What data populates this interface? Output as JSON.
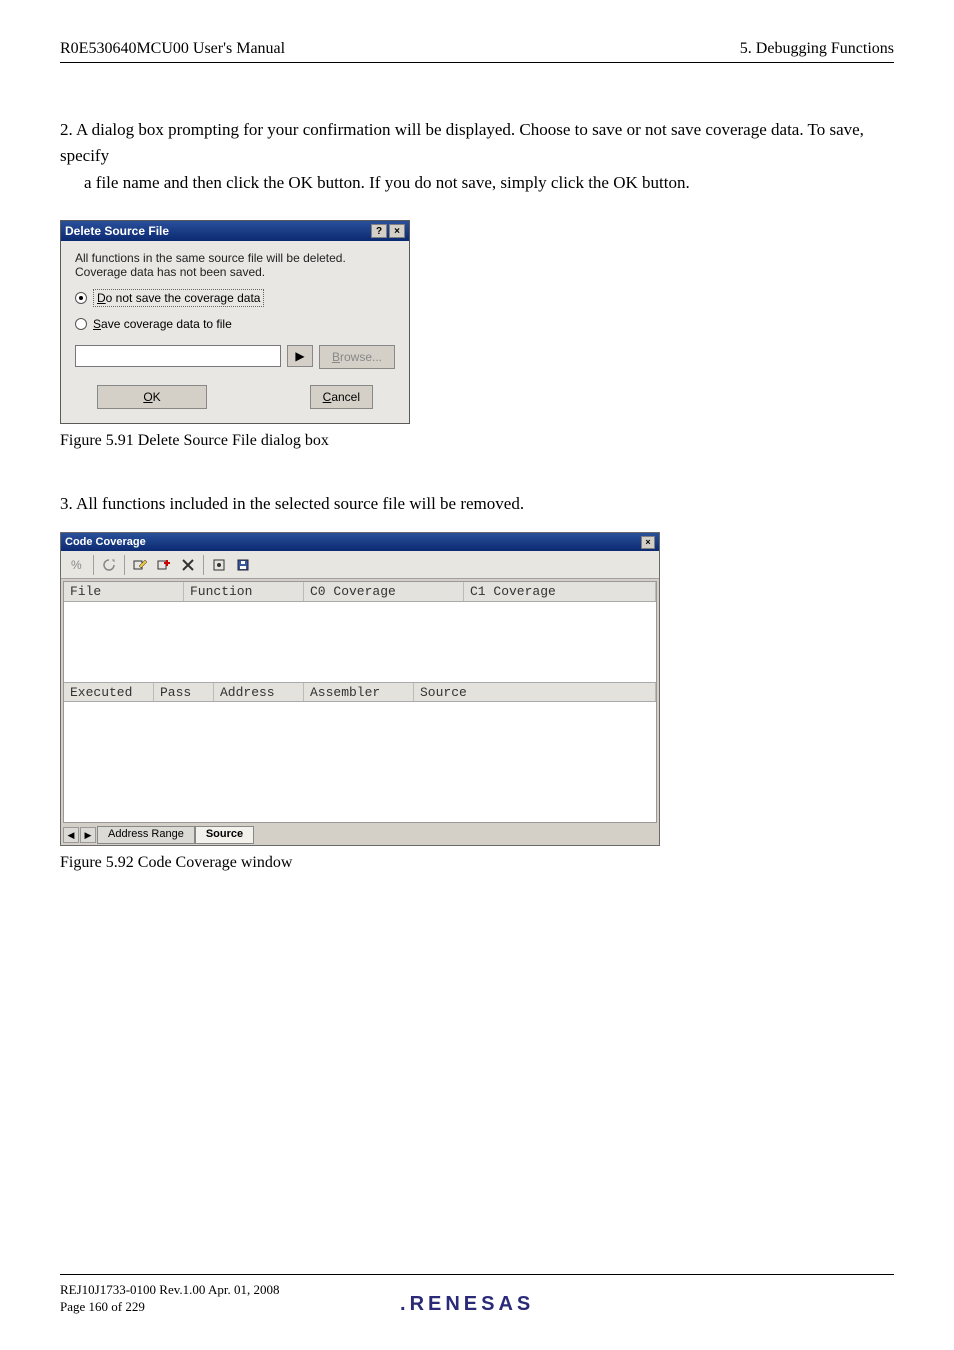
{
  "header": {
    "left": "R0E530640MCU00 User's Manual",
    "right": "5. Debugging Functions"
  },
  "step2": {
    "line1": "2. A dialog box prompting for your confirmation will be displayed. Choose to save or not save coverage data. To save, specify",
    "line2": "a file name and then click the OK button. If you do not save, simply click the OK button."
  },
  "dialog1": {
    "title": "Delete Source File",
    "help_glyph": "?",
    "close_glyph": "×",
    "message_line1": "All functions in the same source file will be deleted.",
    "message_line2": "Coverage data has not been saved.",
    "opt_donotsave_prefix": "D",
    "opt_donotsave_rest": "o not save the coverage data",
    "opt_save_prefix": "S",
    "opt_save_rest": "ave coverage data to file",
    "path_value": "",
    "mru_glyph": "▶",
    "browse_prefix": "B",
    "browse_rest": "rowse...",
    "ok_prefix": "O",
    "ok_rest": "K",
    "cancel_prefix": "C",
    "cancel_rest": "ancel"
  },
  "fig1_caption": "Figure 5.91 Delete Source File dialog box",
  "step3_text": "3. All functions included in the selected source file will be removed.",
  "ccwindow": {
    "title": "Code Coverage",
    "close_glyph": "×",
    "toolbar_icons": [
      "percent",
      "refresh",
      "edit-range",
      "add-range",
      "delete-range",
      "clear",
      "save"
    ],
    "top_columns": [
      "File",
      "Function",
      "C0 Coverage",
      "C1 Coverage"
    ],
    "bottom_columns": [
      "Executed",
      "Pass",
      "Address",
      "Assembler",
      "Source"
    ],
    "nav_prev": "◀",
    "nav_next": "▶",
    "tab_addr": "Address Range",
    "tab_source": "Source"
  },
  "fig2_caption": "Figure 5.92 Code Coverage window",
  "footer": {
    "line1": "REJ10J1733-0100   Rev.1.00   Apr. 01, 2008",
    "line2": "Page 160 of 229",
    "logo_text": "RENESAS"
  }
}
